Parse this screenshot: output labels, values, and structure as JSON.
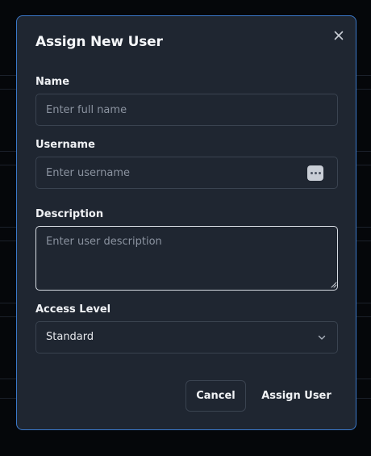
{
  "modal": {
    "title": "Assign New User",
    "close_icon": "close-icon"
  },
  "fields": {
    "name": {
      "label": "Name",
      "placeholder": "Enter full name",
      "value": ""
    },
    "username": {
      "label": "Username",
      "placeholder": "Enter username",
      "value": "",
      "trailing_icon": "password-manager-icon"
    },
    "description": {
      "label": "Description",
      "placeholder": "Enter user description",
      "value": ""
    },
    "access_level": {
      "label": "Access Level",
      "selected": "Standard",
      "icon": "chevron-down-icon"
    }
  },
  "actions": {
    "cancel_label": "Cancel",
    "assign_label": "Assign User"
  },
  "colors": {
    "modal_background": "#1f2631",
    "modal_border": "#3a78c9",
    "backdrop": "#05070a",
    "text_primary": "#f0f2f5",
    "placeholder": "#8b93a0"
  }
}
